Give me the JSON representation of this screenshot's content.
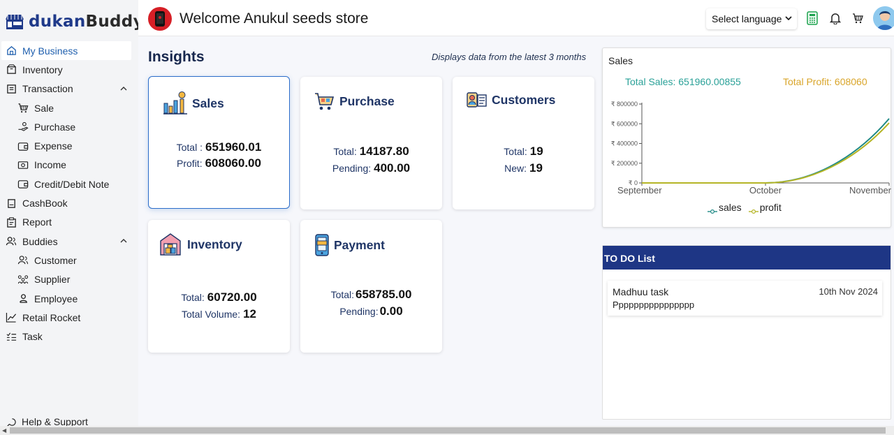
{
  "brand": {
    "part1": "dukan",
    "part2": "Buddy"
  },
  "sidebar": {
    "items": [
      {
        "label": "My Business",
        "icon": "home-store-icon"
      },
      {
        "label": "Inventory",
        "icon": "box-icon"
      },
      {
        "label": "Transaction",
        "icon": "receipt-icon"
      },
      {
        "label": "Sale",
        "icon": "cart-icon"
      },
      {
        "label": "Purchase",
        "icon": "hand-coins-icon"
      },
      {
        "label": "Expense",
        "icon": "wallet-icon"
      },
      {
        "label": "Income",
        "icon": "banknote-icon"
      },
      {
        "label": "Credit/Debit Note",
        "icon": "wallet-icon"
      },
      {
        "label": "CashBook",
        "icon": "book-icon"
      },
      {
        "label": "Report",
        "icon": "clipboard-icon"
      },
      {
        "label": "Buddies",
        "icon": "users-icon"
      },
      {
        "label": "Customer",
        "icon": "user-group-icon"
      },
      {
        "label": "Supplier",
        "icon": "network-icon"
      },
      {
        "label": "Employee",
        "icon": "user-icon"
      },
      {
        "label": "Retail Rocket",
        "icon": "trend-icon"
      },
      {
        "label": "Task",
        "icon": "list-check-icon"
      }
    ],
    "help": "Help & Support"
  },
  "header": {
    "welcome": "Welcome Anukul seeds store",
    "language": "Select language"
  },
  "insights": {
    "title": "Insights",
    "note": "Displays data from the latest 3 months",
    "cards": {
      "sales": {
        "title": "Sales",
        "total_label": "Total :",
        "total": "651960.01",
        "profit_label": "Profit:",
        "profit": "608060.00"
      },
      "purchase": {
        "title": "Purchase",
        "total_label": "Total:",
        "total": "14187.80",
        "pending_label": "Pending:",
        "pending": "400.00"
      },
      "customers": {
        "title": "Customers",
        "total_label": "Total:",
        "total": "19",
        "new_label": "New:",
        "new": "19"
      },
      "inventory": {
        "title": "Inventory",
        "total_label": "Total:",
        "total": "60720.00",
        "volume_label": "Total Volume:",
        "volume": "12"
      },
      "payment": {
        "title": "Payment",
        "total_label": "Total:",
        "total": "658785.00",
        "pending_label": "Pending:",
        "pending": "0.00"
      }
    }
  },
  "sales_panel": {
    "title": "Sales",
    "total_sales": "Total Sales: 651960.00855",
    "total_profit": "Total Profit: 608060",
    "colors": {
      "sales": "#1f8a86",
      "profit": "#b5b526"
    }
  },
  "chart_data": {
    "type": "line",
    "x": [
      "September",
      "October",
      "November"
    ],
    "series": [
      {
        "name": "sales",
        "values": [
          0,
          0,
          651960
        ]
      },
      {
        "name": "profit",
        "values": [
          0,
          0,
          608060
        ]
      }
    ],
    "yticks": [
      "₹ 0",
      "₹ 200000",
      "₹ 400000",
      "₹ 600000",
      "₹ 800000"
    ],
    "ylim": [
      0,
      800000
    ],
    "legend": "bottom",
    "grid": false
  },
  "todo": {
    "title": "TO DO List",
    "items": [
      {
        "title": "Madhuu task",
        "date": "10th Nov 2024",
        "desc": "Pppppppppppppppp"
      }
    ]
  }
}
